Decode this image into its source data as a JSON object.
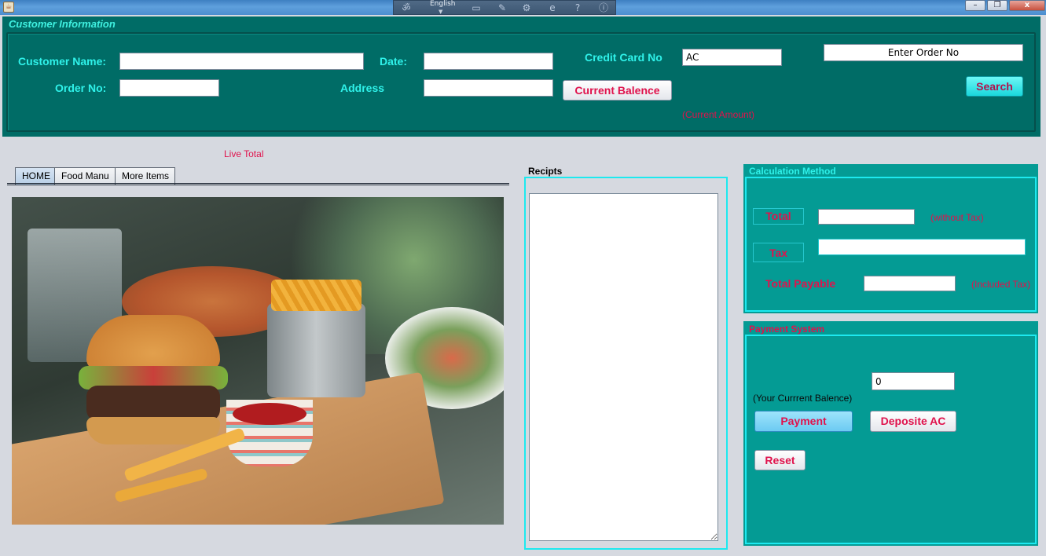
{
  "window": {
    "app_icon": "java-cup-icon",
    "min": "–",
    "max": "❐",
    "close": "x"
  },
  "ime": {
    "language": "English"
  },
  "customer_info": {
    "title": "Customer Information",
    "customer_name_label": "Customer Name:",
    "customer_name_value": "",
    "order_no_label": "Order No:",
    "order_no_value": "",
    "date_label": "Date:",
    "date_value": "",
    "address_label": "Address",
    "address_value": "",
    "credit_card_label": "Credit Card No",
    "credit_card_value": "AC",
    "current_balance_button": "Current Balence",
    "current_amount_hint": "(Current Amount)",
    "order_search_value": "Enter Order No",
    "search_button": "Search"
  },
  "live_total_label": "Live Total",
  "tabs": [
    {
      "label": "HOME",
      "active": true
    },
    {
      "label": "Food Manu",
      "active": false
    },
    {
      "label": "More Items",
      "active": false
    }
  ],
  "receipts": {
    "title": "Recipts",
    "content": ""
  },
  "calculation": {
    "title": "Calculation Method",
    "total_label": "Total",
    "total_value": "",
    "total_hint": "(without Tax)",
    "tax_label": "Tax",
    "tax_value": "",
    "total_payable_label": "Total Payable",
    "total_payable_value": "",
    "total_payable_hint": "(Included Tax)"
  },
  "payment": {
    "title": "Payment System",
    "balance_value": "0",
    "balance_label": "(Your Currrent Balence)",
    "payment_button": "Payment",
    "deposit_button": "Deposite AC",
    "reset_button": "Reset"
  },
  "colors": {
    "header_teal": "#006c66",
    "panel_teal": "#049b94",
    "accent_cyan": "#2ff2ea",
    "accent_red": "#e0124c",
    "background": "#d6d9e0"
  }
}
